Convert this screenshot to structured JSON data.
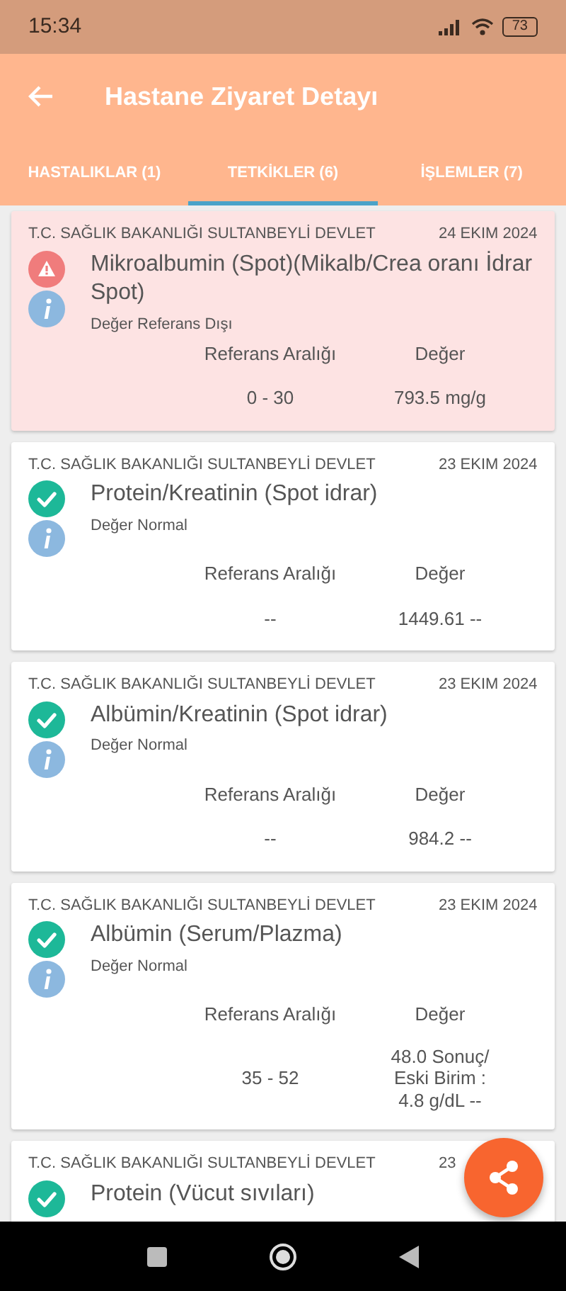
{
  "status_bar": {
    "time": "15:34",
    "battery": "73"
  },
  "header": {
    "title": "Hastane Ziyaret Detayı"
  },
  "tabs": [
    {
      "label": "HASTALIKLAR (1)",
      "selected": false
    },
    {
      "label": "TETKİKLER (6)",
      "selected": true
    },
    {
      "label": "İŞLEMLER (7)",
      "selected": false
    }
  ],
  "tests": [
    {
      "institution": "T.C. SAĞLIK BAKANLIĞI SULTANBEYLİ DEVLET",
      "date": "24 EKIM 2024",
      "kind": "warning",
      "name": "Mikroalbumin (Spot)(Mikalb/Crea oranı İdrar Spot)",
      "status": "Değer Referans Dışı",
      "range_label": "Referans Aralığı",
      "value_label": "Değer",
      "range": "0 - 30",
      "value": "793.5 mg/g"
    },
    {
      "institution": "T.C. SAĞLIK BAKANLIĞI SULTANBEYLİ DEVLET",
      "date": "23 EKIM 2024",
      "kind": "normal",
      "name": "Protein/Kreatinin (Spot idrar)",
      "status": "Değer Normal",
      "range_label": "Referans Aralığı",
      "value_label": "Değer",
      "range": "--",
      "value": "1449.61 --"
    },
    {
      "institution": "T.C. SAĞLIK BAKANLIĞI SULTANBEYLİ DEVLET",
      "date": "23 EKIM 2024",
      "kind": "normal",
      "name": "Albümin/Kreatinin (Spot idrar)",
      "status": "Değer Normal",
      "range_label": "Referans Aralığı",
      "value_label": "Değer",
      "range": "--",
      "value": "984.2 --"
    },
    {
      "institution": "T.C. SAĞLIK BAKANLIĞI SULTANBEYLİ DEVLET",
      "date": "23 EKIM 2024",
      "kind": "normal",
      "name": "Albümin (Serum/Plazma)",
      "status": "Değer Normal",
      "range_label": "Referans Aralığı",
      "value_label": "Değer",
      "range": "35 - 52",
      "value": "48.0 Sonuç/ Eski Birim : 4.8 g/dL --"
    },
    {
      "institution": "T.C. SAĞLIK BAKANLIĞI SULTANBEYLİ DEVLET",
      "date": "23",
      "kind": "normal",
      "name": "Protein (Vücut sıvıları)"
    }
  ]
}
